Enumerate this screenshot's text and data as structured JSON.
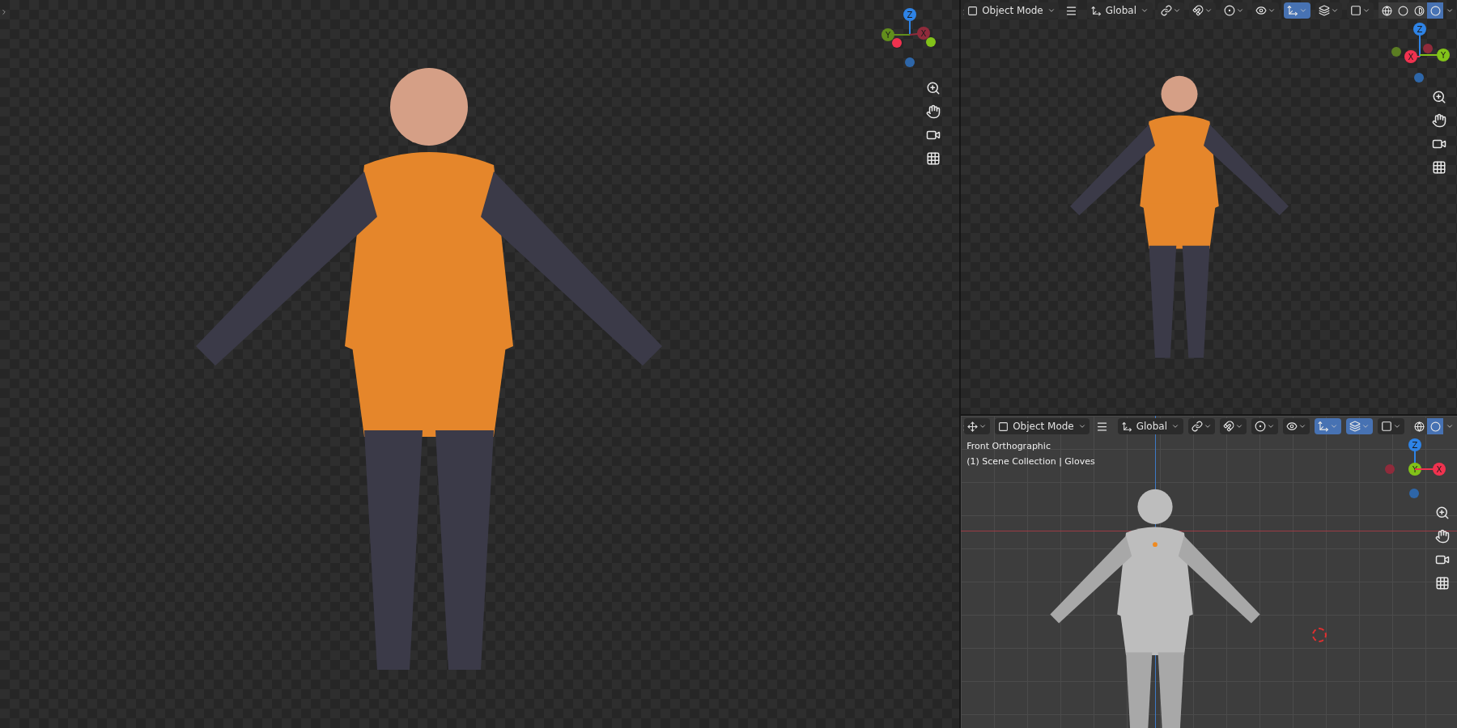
{
  "viewports": [
    {
      "kind": "render",
      "gizmo": [
        {
          "label": "Z",
          "color": "#2e83e6"
        },
        {
          "label": "Y",
          "color": "#628e1c"
        },
        {
          "label": "X",
          "color": "#8f2b3b"
        }
      ]
    },
    {
      "kind": "render",
      "header": {
        "mode": "Object Mode",
        "orientation": "Global",
        "tools": [
          {
            "kind": "pivot",
            "selected": false
          },
          {
            "kind": "snap",
            "selected": false
          },
          {
            "kind": "proportional",
            "selected": false
          },
          {
            "kind": "visibility",
            "selected": false
          },
          {
            "kind": "gizmos",
            "selected": true
          },
          {
            "kind": "overlays",
            "selected": false
          },
          {
            "kind": "xray",
            "selected": false
          }
        ],
        "shading": [
          {
            "selected": false
          },
          {
            "selected": false
          },
          {
            "selected": false
          },
          {
            "selected": true
          }
        ]
      },
      "gizmo": [
        {
          "label": "Z",
          "color": "#2e83e6"
        },
        {
          "label": "X",
          "color": "#f0324f"
        },
        {
          "label": "Y",
          "color": "#82c219"
        }
      ]
    },
    {
      "kind": "solid",
      "header": {
        "editor_type": true,
        "mode": "Object Mode",
        "orientation": "Global",
        "tools": [
          {
            "kind": "pivot",
            "selected": false
          },
          {
            "kind": "snap",
            "selected": false
          },
          {
            "kind": "proportional",
            "selected": false
          },
          {
            "kind": "visibility",
            "selected": false
          },
          {
            "kind": "gizmos",
            "selected": true
          },
          {
            "kind": "overlays",
            "selected": true
          },
          {
            "kind": "xray",
            "selected": false
          }
        ],
        "shading": [
          {
            "selected": false
          },
          {
            "selected": true
          }
        ]
      },
      "info": [
        "Front Orthographic",
        "(1) Scene Collection | Gloves"
      ],
      "gizmo": [
        {
          "label": "Z",
          "color": "#2e83e6"
        },
        {
          "label": "Y",
          "color": "#82c219"
        },
        {
          "label": "X",
          "color": "#f0324f"
        }
      ]
    }
  ]
}
